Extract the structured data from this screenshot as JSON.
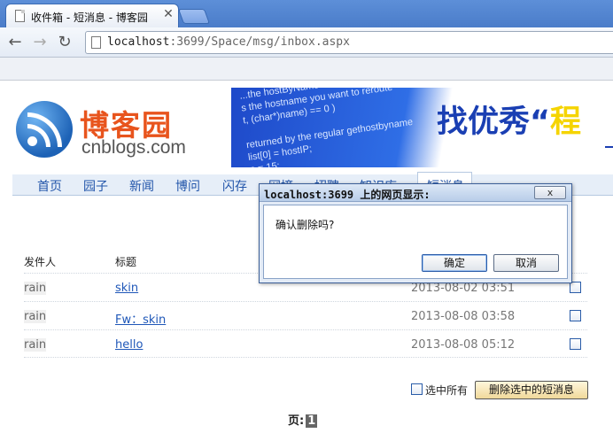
{
  "browser": {
    "tab_title": "收件箱 - 短消息 - 博客园",
    "close_glyph": "✕",
    "url_host": "localhost",
    "url_rest": ":3699/Space/msg/inbox.aspx",
    "back_glyph": "←",
    "forward_glyph": "→",
    "reload_glyph": "↻"
  },
  "logo": {
    "cn": "博客园",
    "en": "cnblogs.com"
  },
  "banner": {
    "slogan_main": "找优秀“",
    "slogan_highlight": "程"
  },
  "nav": {
    "items": [
      "首页",
      "园子",
      "新闻",
      "博问",
      "闪存",
      "网摘",
      "招聘",
      "知识库"
    ],
    "current": "短消息"
  },
  "inbox": {
    "headers": {
      "sender": "发件人",
      "title": "标题"
    },
    "rows": [
      {
        "sender": "rain",
        "title": "skin",
        "date": "2013-08-02 03:51"
      },
      {
        "sender": "rain",
        "title": "Fw：skin",
        "date": "2013-08-08 03:58"
      },
      {
        "sender": "rain",
        "title": "hello",
        "date": "2013-08-08 05:12"
      }
    ],
    "select_all_label": "选中所有",
    "delete_button": "删除选中的短消息",
    "pager_label": "页:",
    "current_page": "1"
  },
  "dialog": {
    "title": "localhost:3699 上的网页显示:",
    "close_glyph": "x",
    "message": "确认删除吗?",
    "ok": "确定",
    "cancel": "取消"
  },
  "colors": {
    "accent": "#1f57b8",
    "logo_orange": "#e8541d",
    "tabstrip_blue": "#4a7cc9"
  }
}
